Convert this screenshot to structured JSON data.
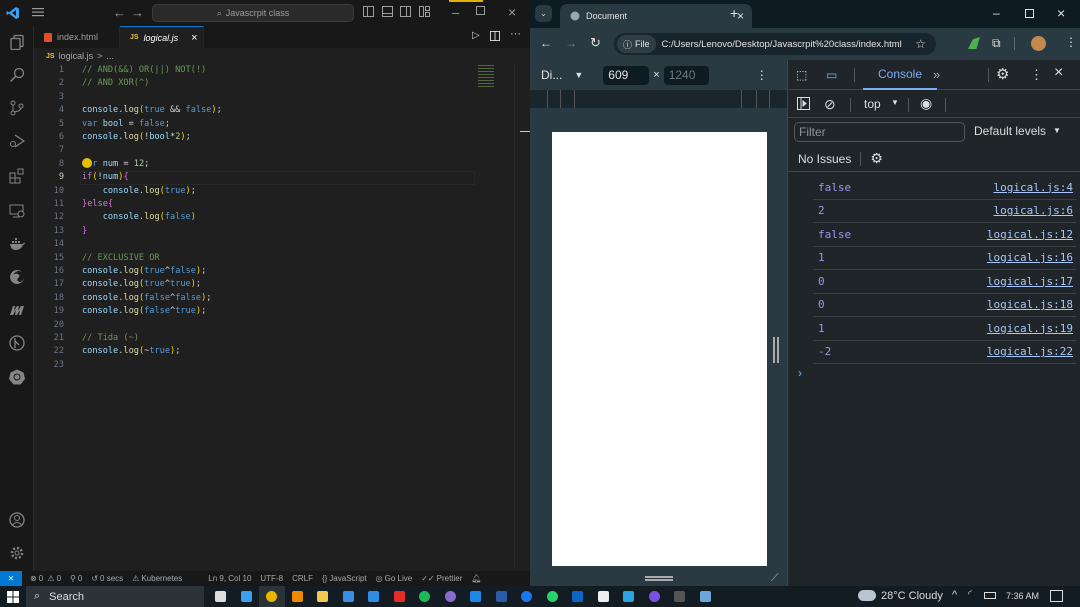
{
  "vscode": {
    "command_center": "Javascrpit class",
    "tabs": [
      {
        "label": "index.html",
        "icon": "html5-icon",
        "active": false
      },
      {
        "label": "logical.js",
        "icon": "js-icon",
        "active": true
      }
    ],
    "breadcrumb": {
      "file": "logical.js",
      "sep": ">",
      "rest": "..."
    },
    "file_badge": "JS",
    "code_lines": [
      {
        "n": "1",
        "tokens": [
          [
            "c-com",
            "// AND(&&) OR(||) NOT(!)"
          ]
        ]
      },
      {
        "n": "2",
        "tokens": [
          [
            "c-com",
            "// AND XOR(^)"
          ]
        ]
      },
      {
        "n": "3",
        "tokens": []
      },
      {
        "n": "4",
        "tokens": [
          [
            "c-id",
            "console"
          ],
          [
            "c-txt",
            "."
          ],
          [
            "c-fn",
            "log"
          ],
          [
            "c-br",
            "("
          ],
          [
            "c-kw",
            "true"
          ],
          [
            "c-txt",
            " && "
          ],
          [
            "c-kw",
            "false"
          ],
          [
            "c-br",
            ")"
          ],
          [
            "c-txt",
            ";"
          ]
        ]
      },
      {
        "n": "5",
        "tokens": [
          [
            "c-kw",
            "var "
          ],
          [
            "c-id",
            "bool"
          ],
          [
            "c-txt",
            " = "
          ],
          [
            "c-kw",
            "false"
          ],
          [
            "c-txt",
            ";"
          ]
        ]
      },
      {
        "n": "6",
        "tokens": [
          [
            "c-id",
            "console"
          ],
          [
            "c-txt",
            "."
          ],
          [
            "c-fn",
            "log"
          ],
          [
            "c-br",
            "("
          ],
          [
            "c-txt",
            "!"
          ],
          [
            "c-id",
            "bool"
          ],
          [
            "c-txt",
            "*"
          ],
          [
            "c-num",
            "2"
          ],
          [
            "c-br",
            ")"
          ],
          [
            "c-txt",
            ";"
          ]
        ]
      },
      {
        "n": "7",
        "tokens": []
      },
      {
        "n": "8",
        "tokens": [
          [
            "c-kw",
            "var "
          ],
          [
            "c-id",
            "num"
          ],
          [
            "c-txt",
            " = "
          ],
          [
            "c-num",
            "12"
          ],
          [
            "c-txt",
            ";"
          ]
        ]
      },
      {
        "n": "9",
        "tokens": [
          [
            "c-ctl",
            "if"
          ],
          [
            "c-br",
            "("
          ],
          [
            "c-txt",
            "!"
          ],
          [
            "c-id",
            "num"
          ],
          [
            "c-br",
            ")"
          ],
          [
            "c-br2",
            "{"
          ]
        ]
      },
      {
        "n": "10",
        "tokens": [
          [
            "c-txt",
            "    "
          ],
          [
            "c-id",
            "console"
          ],
          [
            "c-txt",
            "."
          ],
          [
            "c-fn",
            "log"
          ],
          [
            "c-br",
            "("
          ],
          [
            "c-kw",
            "true"
          ],
          [
            "c-br",
            ")"
          ],
          [
            "c-txt",
            ";"
          ]
        ]
      },
      {
        "n": "11",
        "tokens": [
          [
            "c-br2",
            "}"
          ],
          [
            "c-ctl",
            "else"
          ],
          [
            "c-br2",
            "{"
          ]
        ]
      },
      {
        "n": "12",
        "tokens": [
          [
            "c-txt",
            "    "
          ],
          [
            "c-id",
            "console"
          ],
          [
            "c-txt",
            "."
          ],
          [
            "c-fn",
            "log"
          ],
          [
            "c-br",
            "("
          ],
          [
            "c-kw",
            "false"
          ],
          [
            "c-br",
            ")"
          ]
        ]
      },
      {
        "n": "13",
        "tokens": [
          [
            "c-br2",
            "}"
          ]
        ]
      },
      {
        "n": "14",
        "tokens": []
      },
      {
        "n": "15",
        "tokens": [
          [
            "c-com",
            "// EXCLUSIVE OR"
          ]
        ]
      },
      {
        "n": "16",
        "tokens": [
          [
            "c-id",
            "console"
          ],
          [
            "c-txt",
            "."
          ],
          [
            "c-fn",
            "log"
          ],
          [
            "c-br",
            "("
          ],
          [
            "c-kw",
            "true"
          ],
          [
            "c-txt",
            "^"
          ],
          [
            "c-kw",
            "false"
          ],
          [
            "c-br",
            ")"
          ],
          [
            "c-txt",
            ";"
          ]
        ]
      },
      {
        "n": "17",
        "tokens": [
          [
            "c-id",
            "console"
          ],
          [
            "c-txt",
            "."
          ],
          [
            "c-fn",
            "log"
          ],
          [
            "c-br",
            "("
          ],
          [
            "c-kw",
            "true"
          ],
          [
            "c-txt",
            "^"
          ],
          [
            "c-kw",
            "true"
          ],
          [
            "c-br",
            ")"
          ],
          [
            "c-txt",
            ";"
          ]
        ]
      },
      {
        "n": "18",
        "tokens": [
          [
            "c-id",
            "console"
          ],
          [
            "c-txt",
            "."
          ],
          [
            "c-fn",
            "log"
          ],
          [
            "c-br",
            "("
          ],
          [
            "c-kw",
            "false"
          ],
          [
            "c-txt",
            "^"
          ],
          [
            "c-kw",
            "false"
          ],
          [
            "c-br",
            ")"
          ],
          [
            "c-txt",
            ";"
          ]
        ]
      },
      {
        "n": "19",
        "tokens": [
          [
            "c-id",
            "console"
          ],
          [
            "c-txt",
            "."
          ],
          [
            "c-fn",
            "log"
          ],
          [
            "c-br",
            "("
          ],
          [
            "c-kw",
            "false"
          ],
          [
            "c-txt",
            "^"
          ],
          [
            "c-kw",
            "true"
          ],
          [
            "c-br",
            ")"
          ],
          [
            "c-txt",
            ";"
          ]
        ]
      },
      {
        "n": "20",
        "tokens": []
      },
      {
        "n": "21",
        "tokens": [
          [
            "c-com",
            "// Tida (~)"
          ]
        ]
      },
      {
        "n": "22",
        "tokens": [
          [
            "c-id",
            "console"
          ],
          [
            "c-txt",
            "."
          ],
          [
            "c-fn",
            "log"
          ],
          [
            "c-br",
            "("
          ],
          [
            "c-txt",
            "~"
          ],
          [
            "c-kw",
            "true"
          ],
          [
            "c-br",
            ")"
          ],
          [
            "c-txt",
            ";"
          ]
        ]
      },
      {
        "n": "23",
        "tokens": []
      }
    ],
    "current_line": "9",
    "status": {
      "errors": "0",
      "warnings": "0",
      "ports": "0",
      "time": "0 secs",
      "kubernetes": "Kubernetes",
      "cursor": "Ln 9, Col 10",
      "encoding": "UTF-8",
      "eol": "CRLF",
      "language": "JavaScript",
      "golive": "Go Live",
      "prettier": "Prettier"
    }
  },
  "chrome": {
    "tab_title": "Document",
    "url_chip": "File",
    "url": "C:/Users/Lenovo/Desktop/Javascrpit%20class/index.html",
    "device_label": "Di...",
    "width": "609",
    "times": "×",
    "height_placeholder": "1240",
    "devtools": {
      "panel": "Console",
      "context": "top",
      "filter_placeholder": "Filter",
      "levels": "Default levels",
      "issues": "No Issues",
      "logs": [
        {
          "value": "false",
          "source": "logical.js:4"
        },
        {
          "value": "2",
          "source": "logical.js:6"
        },
        {
          "value": "false",
          "source": "logical.js:12"
        },
        {
          "value": "1",
          "source": "logical.js:16"
        },
        {
          "value": "0",
          "source": "logical.js:17"
        },
        {
          "value": "0",
          "source": "logical.js:18"
        },
        {
          "value": "1",
          "source": "logical.js:19"
        },
        {
          "value": "-2",
          "source": "logical.js:22"
        }
      ],
      "prompt": "›"
    }
  },
  "taskbar": {
    "search": "Search",
    "weather": "28°C  Cloudy",
    "time": "7:36 AM",
    "apps": [
      "task-view",
      "vscode",
      "chrome",
      "vlc",
      "file-explorer",
      "microsoft-store",
      "mail",
      "youtube",
      "spotify",
      "media-player",
      "app-blue",
      "word",
      "facebook",
      "whatsapp",
      "linkedin",
      "capcut",
      "telegram",
      "canva",
      "app-dark",
      "network-app"
    ]
  }
}
